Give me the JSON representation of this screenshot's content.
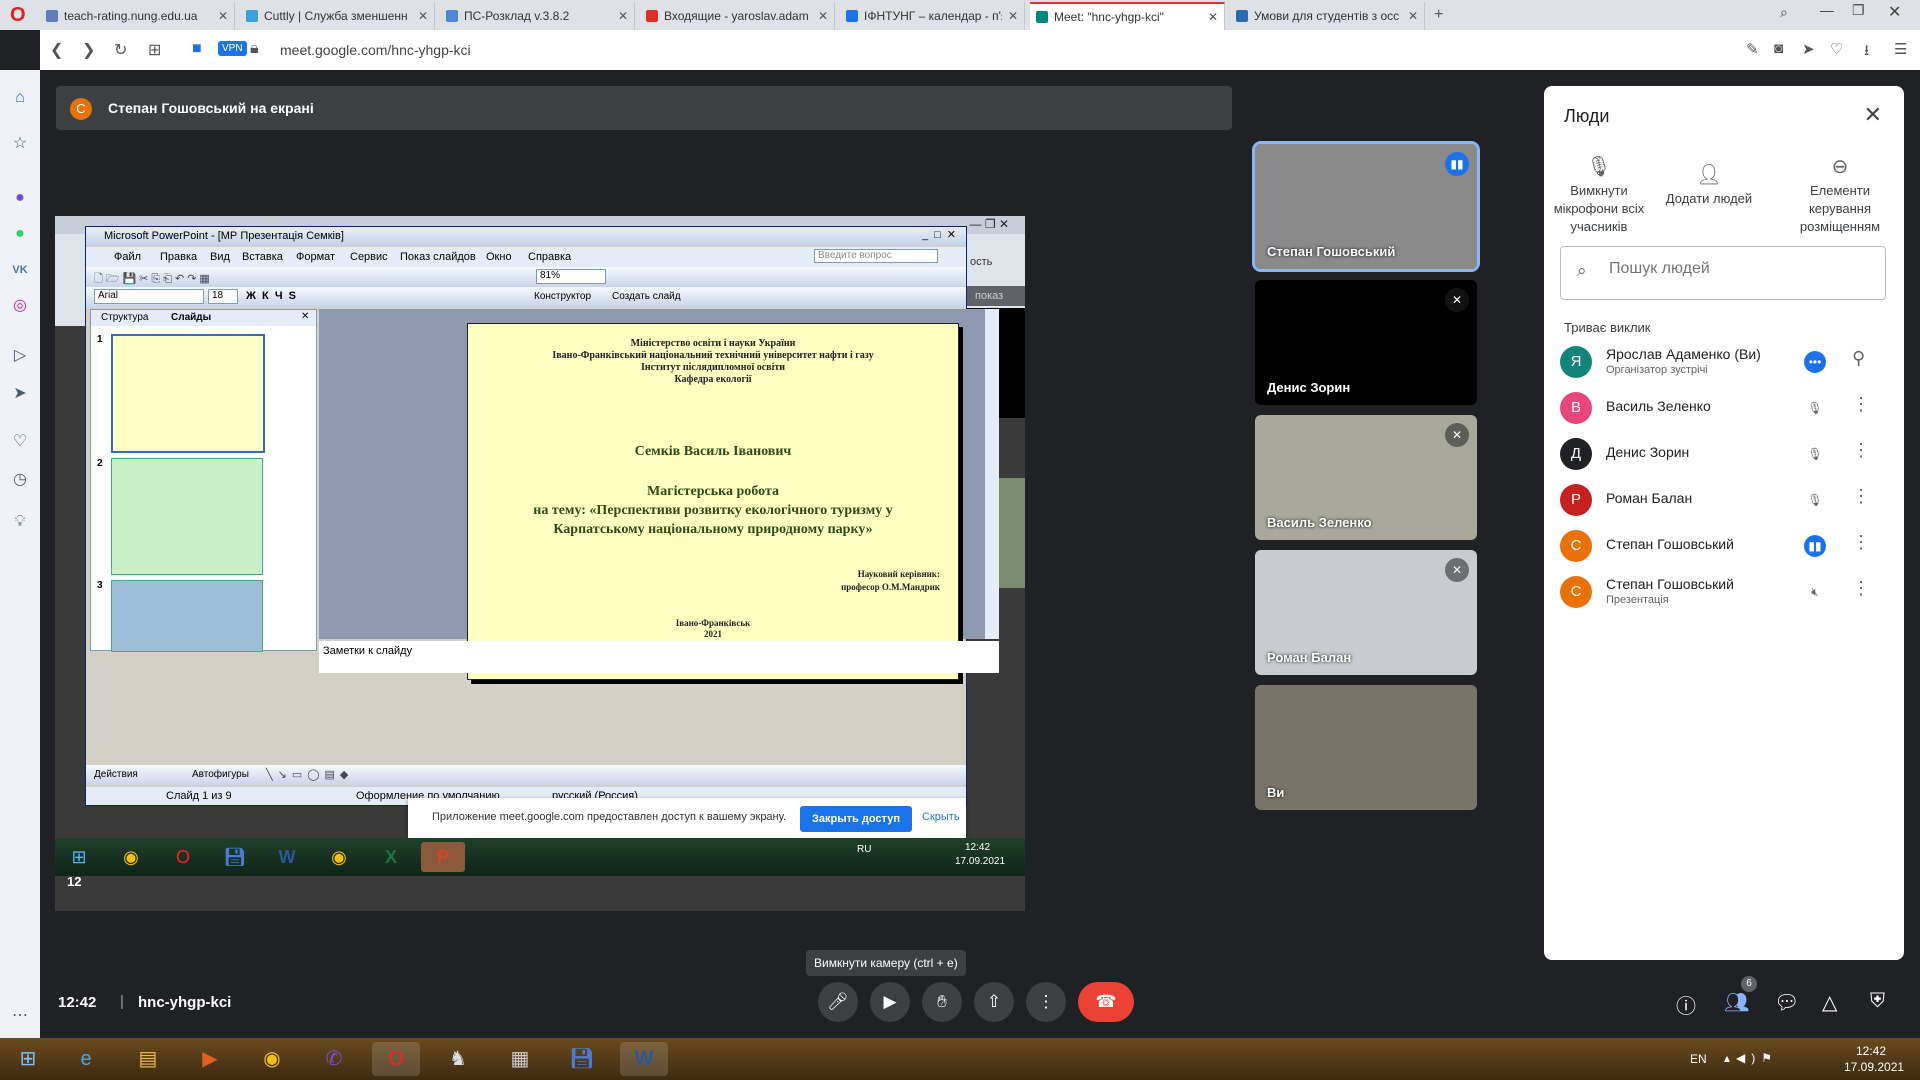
{
  "browser": {
    "tabs": [
      {
        "label": "teach-rating.nung.edu.ua",
        "color": "#5b7fb9"
      },
      {
        "label": "Cuttly | Служба зменшенн",
        "color": "#3aa0e0"
      },
      {
        "label": "ПС-Розклад v.3.8.2",
        "color": "#4a8ad8"
      },
      {
        "label": "Входящие - yaroslav.adam",
        "color": "#d93025"
      },
      {
        "label": "ІФНТУНГ – календар - п'ят",
        "color": "#1a73e8"
      },
      {
        "label": "Meet: \"hnc-yhgp-kci\"",
        "color": "#00897b"
      },
      {
        "label": "Умови для студентів з осс",
        "color": "#2a6ab0"
      }
    ],
    "url": "meet.google.com/hnc-yhgp-kci",
    "vpn_label": "VPN"
  },
  "meet": {
    "presenter_banner": {
      "avatar": "С",
      "text": "Степан Гошовський на екрані"
    },
    "shared_screen": {
      "window_title": "Microsoft PowerPoint - [МР Презентація Семків]",
      "menu": [
        "Файл",
        "Правка",
        "Вид",
        "Вставка",
        "Формат",
        "Сервис",
        "Показ слайдов",
        "Окно",
        "Справка"
      ],
      "ask_placeholder": "Введите вопрос",
      "zoom": "81%",
      "font": "Arial",
      "font_size": "18",
      "designer": "Конструктор",
      "create_slide": "Создать слайд",
      "left_tabs": [
        "Структура",
        "Слайды"
      ],
      "slide_numbers": [
        "1",
        "2",
        "3"
      ],
      "slide": {
        "header_lines": [
          "Міністерство освіти і науки України",
          "Івано-Франківський національний технічний університет нафти і газу",
          "Інститут післядипломної освіти",
          "Кафедра екології"
        ],
        "author": "Семків Василь Іванович",
        "work_lines": [
          "Магістерська робота",
          "на тему: «Перспективи розвитку екологічного туризму у",
          "Карпатському національному природному парку»"
        ],
        "supervisor_lines": [
          "Науковий керівник:",
          "професор О.М.Мандрик"
        ],
        "city_lines": [
          "Івано-Франківськ",
          "2021"
        ]
      },
      "notes": "Заметки к слайду",
      "draw_toolbar": {
        "actions": "Действия",
        "autoshapes": "Автофигуры"
      },
      "status": {
        "slide": "Слайд 1 из 9",
        "design": "Оформление по умолчанию",
        "lang": "русский (Россия)"
      },
      "share_bar": {
        "message": "Приложение meet.google.com предоставлен доступ к вашему экрану.",
        "stop": "Закрыть доступ",
        "hide": "Скрыть"
      },
      "inner_taskbar": {
        "lang": "RU",
        "time": "12:42",
        "date": "17.09.2021"
      },
      "inner_side_label": "показ",
      "inner_side_label2": "ость",
      "inner_time": "12"
    },
    "tiles": [
      {
        "name": "Степан Гошовський",
        "speaking": true,
        "bg": "#8a8a8a"
      },
      {
        "name": "Денис Зорин",
        "speaking": false,
        "bg": "#000000"
      },
      {
        "name": "Василь Зеленко",
        "speaking": false,
        "bg": "#a8a99a"
      },
      {
        "name": "Роман Балан",
        "speaking": false,
        "bg": "#c8ccd0"
      },
      {
        "name": "Ви",
        "speaking": false,
        "bg": "#7a7468"
      }
    ],
    "people": {
      "title": "Люди",
      "actions": [
        {
          "label": "Вимкнути мікрофони всіх учасників",
          "icon": "mic-off-icon"
        },
        {
          "label": "Додати людей",
          "icon": "add-person-icon"
        },
        {
          "label": "Елементи керування розміщенням",
          "icon": "toggle-icon"
        }
      ],
      "search_placeholder": "Пошук людей",
      "section": "Триває виклик",
      "list": [
        {
          "avatar": "Я",
          "name": "Ярослав Адаменко (Ви)",
          "sub": "Організатор зустрічі",
          "color": "#12857a",
          "mic": "speaking",
          "extra": "pin-icon"
        },
        {
          "avatar": "В",
          "name": "Василь Зеленко",
          "sub": "",
          "color": "#e8467c",
          "mic": "muted"
        },
        {
          "avatar": "Д",
          "name": "Денис Зорин",
          "sub": "",
          "color": "#202124",
          "mic": "muted"
        },
        {
          "avatar": "Р",
          "name": "Роман Балан",
          "sub": "",
          "color": "#c5221f",
          "mic": "muted"
        },
        {
          "avatar": "С",
          "name": "Степан Гошовський",
          "sub": "",
          "color": "#e8710a",
          "mic": "speaking"
        },
        {
          "avatar": "С",
          "name": "Степан Гошовський",
          "sub": "Презентація",
          "color": "#e8710a",
          "mic": "sound-off"
        }
      ]
    },
    "bottom": {
      "time": "12:42",
      "separator": "|",
      "code": "hnc-yhgp-kci",
      "tooltip": "Вимкнути камеру (ctrl + e)",
      "participants_count": "6"
    }
  },
  "windows_taskbar": {
    "lang": "EN",
    "time": "12:42",
    "date": "17.09.2021"
  }
}
